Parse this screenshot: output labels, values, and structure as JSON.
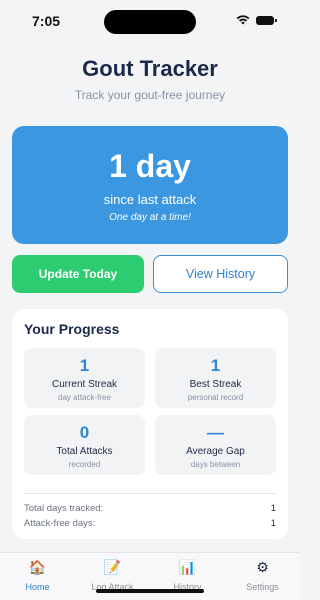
{
  "status_bar": {
    "time": "7:05"
  },
  "header": {
    "title": "Gout Tracker",
    "subtitle": "Track your gout-free journey"
  },
  "hero": {
    "days": "1 day",
    "since": "since last attack",
    "motto": "One day at a time!",
    "color": "#3b97e0"
  },
  "actions": {
    "update_label": "Update Today",
    "history_label": "View History",
    "update_color": "#2ecc71",
    "history_color": "#3b8fd9"
  },
  "progress": {
    "title": "Your Progress",
    "stats": [
      {
        "value": "1",
        "label": "Current Streak",
        "sub": "day attack-free"
      },
      {
        "value": "1",
        "label": "Best Streak",
        "sub": "personal record"
      },
      {
        "value": "0",
        "label": "Total Attacks",
        "sub": "recorded"
      },
      {
        "value": "—",
        "label": "Average Gap",
        "sub": "days between"
      }
    ],
    "summary": [
      {
        "label": "Total days tracked:",
        "value": "1"
      },
      {
        "label": "Attack-free days:",
        "value": "1"
      }
    ]
  },
  "tab_bar": {
    "tabs": [
      {
        "label": "Home",
        "icon": "house-icon",
        "glyph": "🏠",
        "active": true
      },
      {
        "label": "Log Attack",
        "icon": "memo-icon",
        "glyph": "📝",
        "active": false
      },
      {
        "label": "History",
        "icon": "chart-icon",
        "glyph": "📊",
        "active": false
      },
      {
        "label": "Settings",
        "icon": "gear-icon",
        "glyph": "⚙",
        "active": false
      }
    ],
    "active_color": "#2f80c9"
  }
}
